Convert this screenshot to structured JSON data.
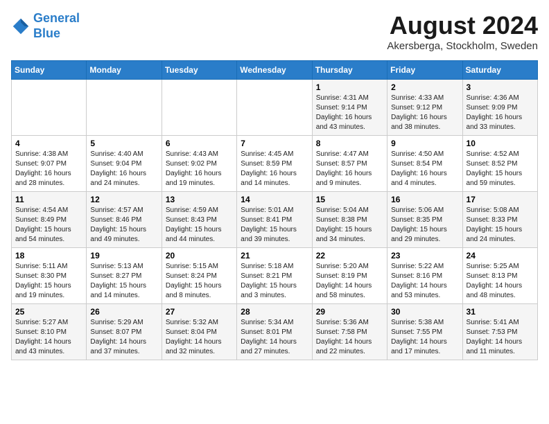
{
  "header": {
    "logo_line1": "General",
    "logo_line2": "Blue",
    "month": "August 2024",
    "location": "Akersberga, Stockholm, Sweden"
  },
  "weekdays": [
    "Sunday",
    "Monday",
    "Tuesday",
    "Wednesday",
    "Thursday",
    "Friday",
    "Saturday"
  ],
  "weeks": [
    [
      {
        "day": "",
        "info": ""
      },
      {
        "day": "",
        "info": ""
      },
      {
        "day": "",
        "info": ""
      },
      {
        "day": "",
        "info": ""
      },
      {
        "day": "1",
        "info": "Sunrise: 4:31 AM\nSunset: 9:14 PM\nDaylight: 16 hours\nand 43 minutes."
      },
      {
        "day": "2",
        "info": "Sunrise: 4:33 AM\nSunset: 9:12 PM\nDaylight: 16 hours\nand 38 minutes."
      },
      {
        "day": "3",
        "info": "Sunrise: 4:36 AM\nSunset: 9:09 PM\nDaylight: 16 hours\nand 33 minutes."
      }
    ],
    [
      {
        "day": "4",
        "info": "Sunrise: 4:38 AM\nSunset: 9:07 PM\nDaylight: 16 hours\nand 28 minutes."
      },
      {
        "day": "5",
        "info": "Sunrise: 4:40 AM\nSunset: 9:04 PM\nDaylight: 16 hours\nand 24 minutes."
      },
      {
        "day": "6",
        "info": "Sunrise: 4:43 AM\nSunset: 9:02 PM\nDaylight: 16 hours\nand 19 minutes."
      },
      {
        "day": "7",
        "info": "Sunrise: 4:45 AM\nSunset: 8:59 PM\nDaylight: 16 hours\nand 14 minutes."
      },
      {
        "day": "8",
        "info": "Sunrise: 4:47 AM\nSunset: 8:57 PM\nDaylight: 16 hours\nand 9 minutes."
      },
      {
        "day": "9",
        "info": "Sunrise: 4:50 AM\nSunset: 8:54 PM\nDaylight: 16 hours\nand 4 minutes."
      },
      {
        "day": "10",
        "info": "Sunrise: 4:52 AM\nSunset: 8:52 PM\nDaylight: 15 hours\nand 59 minutes."
      }
    ],
    [
      {
        "day": "11",
        "info": "Sunrise: 4:54 AM\nSunset: 8:49 PM\nDaylight: 15 hours\nand 54 minutes."
      },
      {
        "day": "12",
        "info": "Sunrise: 4:57 AM\nSunset: 8:46 PM\nDaylight: 15 hours\nand 49 minutes."
      },
      {
        "day": "13",
        "info": "Sunrise: 4:59 AM\nSunset: 8:43 PM\nDaylight: 15 hours\nand 44 minutes."
      },
      {
        "day": "14",
        "info": "Sunrise: 5:01 AM\nSunset: 8:41 PM\nDaylight: 15 hours\nand 39 minutes."
      },
      {
        "day": "15",
        "info": "Sunrise: 5:04 AM\nSunset: 8:38 PM\nDaylight: 15 hours\nand 34 minutes."
      },
      {
        "day": "16",
        "info": "Sunrise: 5:06 AM\nSunset: 8:35 PM\nDaylight: 15 hours\nand 29 minutes."
      },
      {
        "day": "17",
        "info": "Sunrise: 5:08 AM\nSunset: 8:33 PM\nDaylight: 15 hours\nand 24 minutes."
      }
    ],
    [
      {
        "day": "18",
        "info": "Sunrise: 5:11 AM\nSunset: 8:30 PM\nDaylight: 15 hours\nand 19 minutes."
      },
      {
        "day": "19",
        "info": "Sunrise: 5:13 AM\nSunset: 8:27 PM\nDaylight: 15 hours\nand 14 minutes."
      },
      {
        "day": "20",
        "info": "Sunrise: 5:15 AM\nSunset: 8:24 PM\nDaylight: 15 hours\nand 8 minutes."
      },
      {
        "day": "21",
        "info": "Sunrise: 5:18 AM\nSunset: 8:21 PM\nDaylight: 15 hours\nand 3 minutes."
      },
      {
        "day": "22",
        "info": "Sunrise: 5:20 AM\nSunset: 8:19 PM\nDaylight: 14 hours\nand 58 minutes."
      },
      {
        "day": "23",
        "info": "Sunrise: 5:22 AM\nSunset: 8:16 PM\nDaylight: 14 hours\nand 53 minutes."
      },
      {
        "day": "24",
        "info": "Sunrise: 5:25 AM\nSunset: 8:13 PM\nDaylight: 14 hours\nand 48 minutes."
      }
    ],
    [
      {
        "day": "25",
        "info": "Sunrise: 5:27 AM\nSunset: 8:10 PM\nDaylight: 14 hours\nand 43 minutes."
      },
      {
        "day": "26",
        "info": "Sunrise: 5:29 AM\nSunset: 8:07 PM\nDaylight: 14 hours\nand 37 minutes."
      },
      {
        "day": "27",
        "info": "Sunrise: 5:32 AM\nSunset: 8:04 PM\nDaylight: 14 hours\nand 32 minutes."
      },
      {
        "day": "28",
        "info": "Sunrise: 5:34 AM\nSunset: 8:01 PM\nDaylight: 14 hours\nand 27 minutes."
      },
      {
        "day": "29",
        "info": "Sunrise: 5:36 AM\nSunset: 7:58 PM\nDaylight: 14 hours\nand 22 minutes."
      },
      {
        "day": "30",
        "info": "Sunrise: 5:38 AM\nSunset: 7:55 PM\nDaylight: 14 hours\nand 17 minutes."
      },
      {
        "day": "31",
        "info": "Sunrise: 5:41 AM\nSunset: 7:53 PM\nDaylight: 14 hours\nand 11 minutes."
      }
    ]
  ]
}
